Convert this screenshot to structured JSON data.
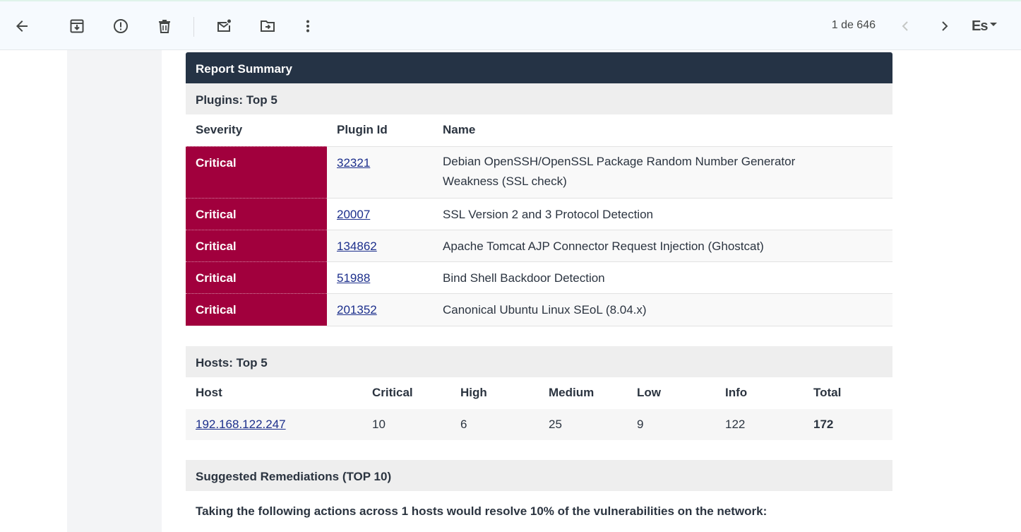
{
  "toolbar": {
    "pager": "1 de 646",
    "lang": "Es"
  },
  "report": {
    "title": "Report Summary",
    "plugins": {
      "heading": "Plugins: Top 5",
      "columns": [
        "Severity",
        "Plugin Id",
        "Name"
      ],
      "rows": [
        {
          "severity": "Critical",
          "id": "32321",
          "name_line1": "Debian OpenSSH/OpenSSL Package Random Number Generator",
          "name_line2": "Weakness (SSL check)"
        },
        {
          "severity": "Critical",
          "id": "20007",
          "name_line1": "SSL Version 2 and 3 Protocol Detection",
          "name_line2": ""
        },
        {
          "severity": "Critical",
          "id": "134862",
          "name_line1": "Apache Tomcat AJP Connector Request Injection (Ghostcat)",
          "name_line2": ""
        },
        {
          "severity": "Critical",
          "id": "51988",
          "name_line1": "Bind Shell Backdoor Detection",
          "name_line2": ""
        },
        {
          "severity": "Critical",
          "id": "201352",
          "name_line1": "Canonical Ubuntu Linux SEoL (8.04.x)",
          "name_line2": ""
        }
      ]
    },
    "hosts": {
      "heading": "Hosts: Top 5",
      "columns": [
        "Host",
        "Critical",
        "High",
        "Medium",
        "Low",
        "Info",
        "Total"
      ],
      "rows": [
        {
          "host": "192.168.122.247",
          "critical": "10",
          "high": "6",
          "medium": "25",
          "low": "9",
          "info": "122",
          "total": "172"
        }
      ]
    },
    "remediations": {
      "heading": "Suggested Remediations (TOP 10)",
      "text": "Taking the following actions across 1 hosts would resolve 10% of the vulnerabilities on the network:"
    }
  },
  "colors": {
    "header": "#253345",
    "critical": "#a1003d",
    "link": "#1c2f8c"
  }
}
